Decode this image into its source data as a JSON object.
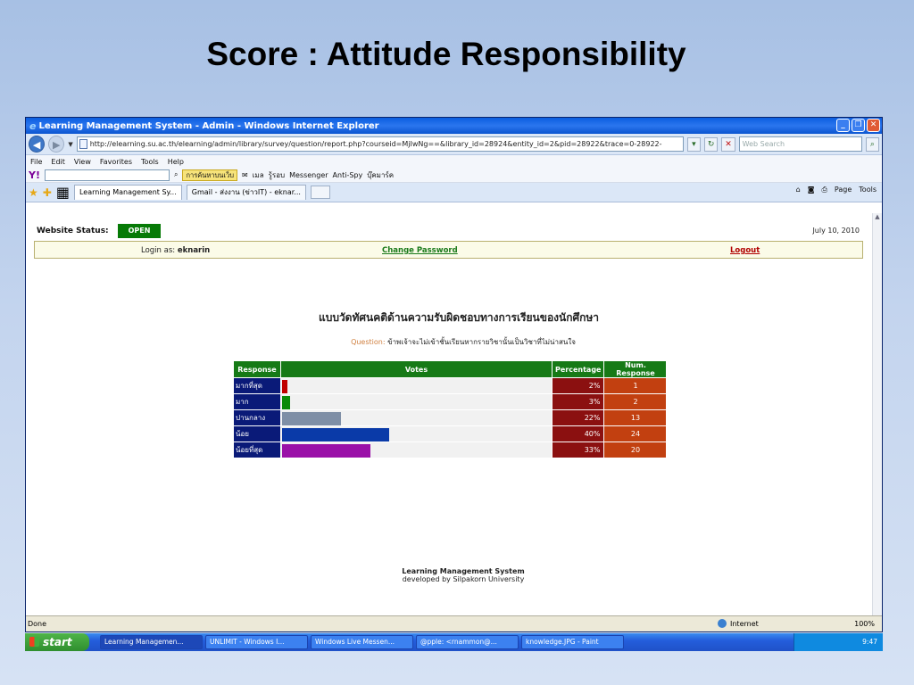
{
  "slide": {
    "title": "Score : Attitude Responsibility"
  },
  "window": {
    "title": "Learning Management System - Admin - Windows Internet Explorer",
    "url": "http://elearning.su.ac.th/elearning/admin/library/survey/question/report.php?courseid=MjIwNg==&library_id=28924&entity_id=2&pid=28922&trace=0-28922-",
    "search_placeholder": "Web Search"
  },
  "menubar": {
    "items": [
      "File",
      "Edit",
      "View",
      "Favorites",
      "Tools",
      "Help"
    ]
  },
  "yahoobar": {
    "search_button": "การค้นหาบนเว็บ",
    "items": [
      "เมล",
      "รู้รอบ",
      "Messenger",
      "Anti-Spy",
      "บุ๊คมาร์ค"
    ]
  },
  "tabs": [
    {
      "label": "Learning Management Sy..."
    },
    {
      "label": "Gmail - ส่งงาน (ข่าวIT) - eknar..."
    }
  ],
  "commandbar": {
    "page": "Page",
    "tools": "Tools"
  },
  "site": {
    "status_label": "Website Status:",
    "status_value": "OPEN",
    "date": "July 10, 2010",
    "login_label": "Login as:",
    "login_user": "eknarin",
    "change_password": "Change Password",
    "logout": "Logout"
  },
  "survey": {
    "title": "แบบวัดทัศนคติด้านความรับผิดชอบทางการเรียนของนักศึกษา",
    "question_label": "Question:",
    "question_text": "ข้าพเจ้าจะไม่เข้าชั้นเรียนหากรายวิชานั้นเป็นวิชาที่ไม่น่าสนใจ",
    "headers": [
      "Response",
      "Votes",
      "Percentage",
      "Num. Response"
    ],
    "rows": [
      {
        "response": "มากที่สุด",
        "percent": 2,
        "percent_label": "2%",
        "count": "1",
        "bar_color": "#c00000"
      },
      {
        "response": "มาก",
        "percent": 3,
        "percent_label": "3%",
        "count": "2",
        "bar_color": "#0a8a0a"
      },
      {
        "response": "ปานกลาง",
        "percent": 22,
        "percent_label": "22%",
        "count": "13",
        "bar_color": "#7f8fa6"
      },
      {
        "response": "น้อย",
        "percent": 40,
        "percent_label": "40%",
        "count": "24",
        "bar_color": "#0a3aa8"
      },
      {
        "response": "น้อยที่สุด",
        "percent": 33,
        "percent_label": "33%",
        "count": "20",
        "bar_color": "#9a10a8"
      }
    ]
  },
  "footer": {
    "name": "Learning Management System",
    "sub": "developed by Silpakorn University"
  },
  "statusbar": {
    "left": "Done",
    "zone": "Internet",
    "zoom": "100%"
  },
  "taskbar": {
    "start": "start",
    "items": [
      "Learning Managemen...",
      "UNLIMIT - Windows I...",
      "Windows Live Messen...",
      "@pple: <rnammon@...",
      "knowledge.JPG - Paint"
    ],
    "clock": "9:47"
  }
}
